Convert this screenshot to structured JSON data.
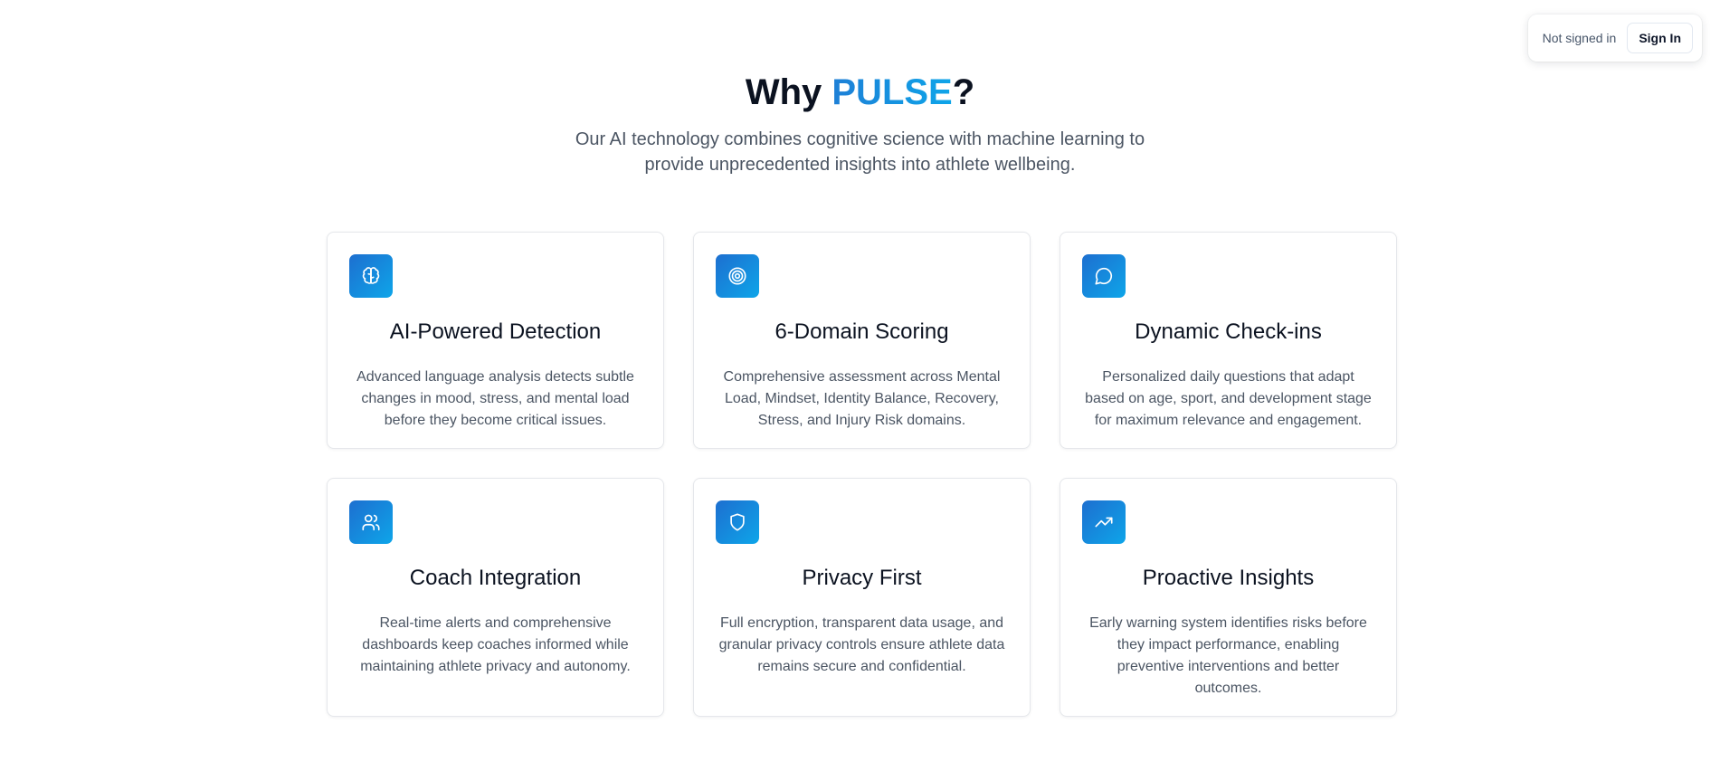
{
  "auth": {
    "status": "Not signed in",
    "sign_in_label": "Sign In"
  },
  "hero": {
    "title_prefix": "Why ",
    "title_accent": "PULSE",
    "title_suffix": "?",
    "subtitle": "Our AI technology combines cognitive science with machine learning to provide unprecedented insights into athlete wellbeing."
  },
  "colors": {
    "accent": "#0ea5e9",
    "accent_dark": "#1d6fd0"
  },
  "features": [
    {
      "icon": "brain-icon",
      "title": "AI-Powered Detection",
      "description": "Advanced language analysis detects subtle changes in mood, stress, and mental load before they become critical issues."
    },
    {
      "icon": "target-icon",
      "title": "6-Domain Scoring",
      "description": "Comprehensive assessment across Mental Load, Mindset, Identity Balance, Recovery, Stress, and Injury Risk domains."
    },
    {
      "icon": "message-circle-icon",
      "title": "Dynamic Check-ins",
      "description": "Personalized daily questions that adapt based on age, sport, and development stage for maximum relevance and engagement."
    },
    {
      "icon": "users-icon",
      "title": "Coach Integration",
      "description": "Real-time alerts and comprehensive dashboards keep coaches informed while maintaining athlete privacy and autonomy."
    },
    {
      "icon": "shield-icon",
      "title": "Privacy First",
      "description": "Full encryption, transparent data usage, and granular privacy controls ensure athlete data remains secure and confidential."
    },
    {
      "icon": "trending-up-icon",
      "title": "Proactive Insights",
      "description": "Early warning system identifies risks before they impact performance, enabling preventive interventions and better outcomes."
    }
  ]
}
